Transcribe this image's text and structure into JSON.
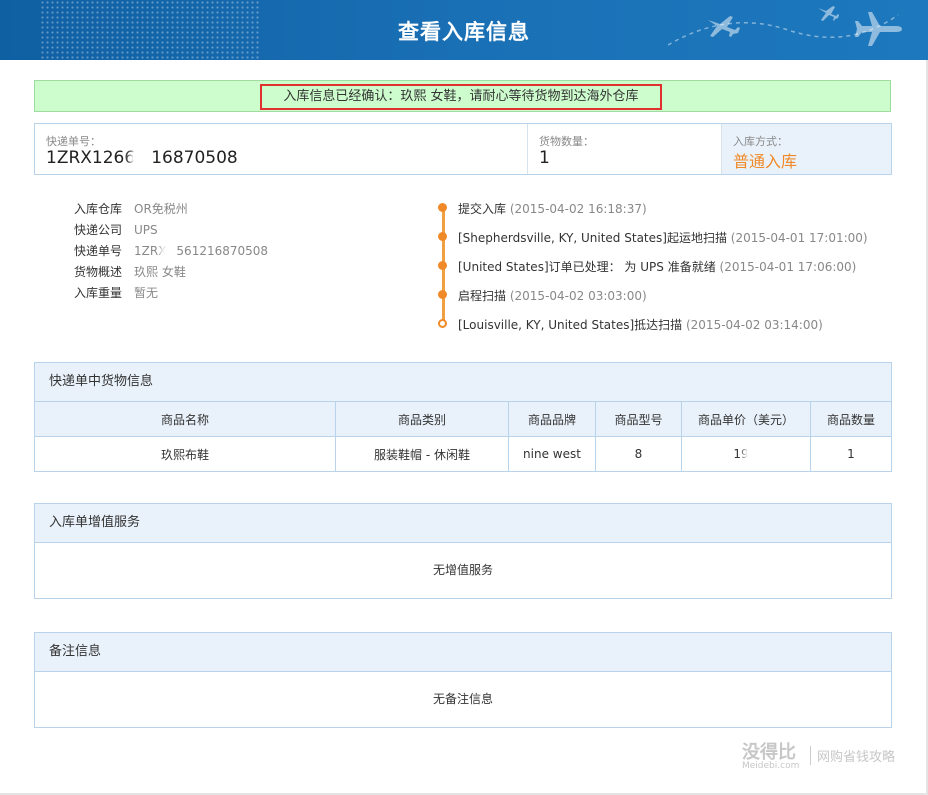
{
  "header": {
    "title": "查看入库信息"
  },
  "notice": {
    "text": "入库信息已经确认：玖熙 女鞋，请耐心等待货物到达海外仓库"
  },
  "info": {
    "tracking_label": "快递单号：",
    "tracking_value_a": "1ZRX1266",
    "tracking_value_b": "16870508",
    "quantity_label": "货物数量：",
    "quantity_value": "1",
    "method_label": "入库方式：",
    "method_value": "普通入库",
    "method_color": "#f08a28"
  },
  "details": [
    {
      "key": "入库仓库",
      "value": "OR免税州"
    },
    {
      "key": "快递公司",
      "value": "UPS"
    },
    {
      "key": "快递单号",
      "value_a": "1ZRX",
      "value_b": "561216870508"
    },
    {
      "key": "货物概述",
      "value": "玖熙 女鞋"
    },
    {
      "key": "入库重量",
      "value": "暂无"
    }
  ],
  "timeline": [
    {
      "text": "提交入库",
      "time": "(2015-04-02 16:18:37)"
    },
    {
      "text": "[Shepherdsville, KY, United States]起运地扫描",
      "time": "(2015-04-01 17:01:00)"
    },
    {
      "text": "[United States]订单已处理： 为 UPS 准备就绪",
      "time": "(2015-04-01 17:06:00)"
    },
    {
      "text": "启程扫描",
      "time": "(2015-04-02 03:03:00)"
    },
    {
      "text": "[Louisville, KY, United States]抵达扫描",
      "time": "(2015-04-02 03:14:00)"
    }
  ],
  "goods": {
    "title": "快递单中货物信息",
    "headers": [
      "商品名称",
      "商品类别",
      "商品品牌",
      "商品型号",
      "商品单价（美元）",
      "商品数量"
    ],
    "row": [
      "玖熙布鞋",
      "服装鞋帽 - 休闲鞋",
      "nine west",
      "8",
      "19",
      "1"
    ]
  },
  "services": {
    "title": "入库单增值服务",
    "empty": "无增值服务"
  },
  "remarks": {
    "title": "备注信息",
    "empty": "无备注信息"
  },
  "watermark": {
    "brand": "没得比",
    "domain": "Meidebi.com",
    "slogan": "网购省钱攻略"
  },
  "colors": {
    "header_blue": "#1a70b5",
    "notice_green": "#cdfccd",
    "accent_orange": "#f08a28",
    "panel_header": "#e9f2fb"
  }
}
